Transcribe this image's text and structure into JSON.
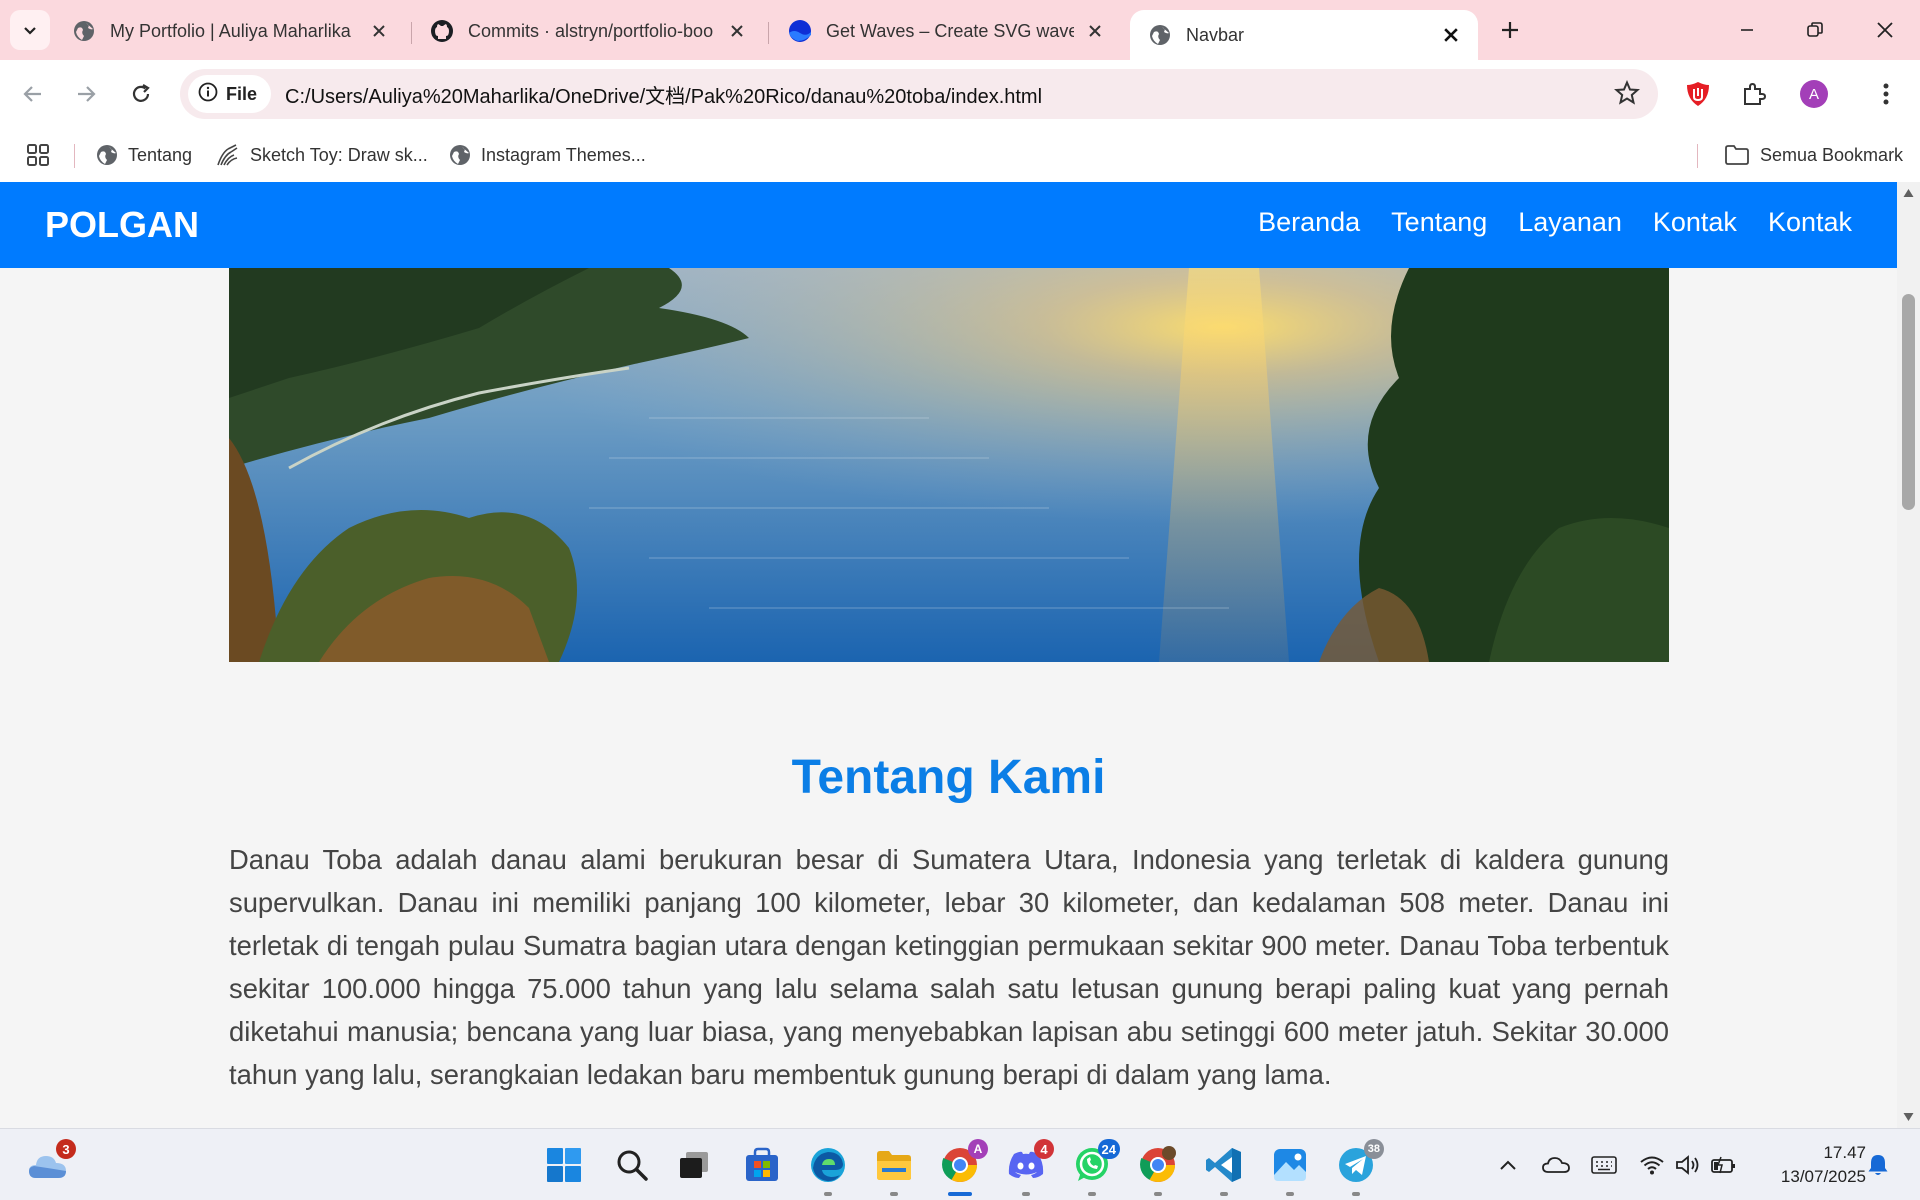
{
  "browser": {
    "tabs": [
      {
        "title": "My Portfolio | Auliya Maharlika",
        "icon": "globe-icon",
        "active": false
      },
      {
        "title": "Commits · alstryn/portfolio-boo",
        "icon": "github-icon",
        "active": false
      },
      {
        "title": "Get Waves – Create SVG waves",
        "icon": "getwaves-icon",
        "active": false
      },
      {
        "title": "Navbar",
        "icon": "globe-icon",
        "active": true
      }
    ],
    "site_chip": "File",
    "url": "C:/Users/Auliya%20Maharlika/OneDrive/文档/Pak%20Rico/danau%20toba/index.html",
    "profile_initial": "A",
    "bookmarks": [
      {
        "label": "Tentang",
        "icon": "globe-icon"
      },
      {
        "label": "Sketch Toy: Draw sk...",
        "icon": "sketch-icon"
      },
      {
        "label": "Instagram Themes...",
        "icon": "globe-icon"
      }
    ],
    "all_bookmarks": "Semua Bookmark"
  },
  "page": {
    "brand": "POLGAN",
    "nav": [
      "Beranda",
      "Tentang",
      "Layanan",
      "Kontak",
      "Kontak"
    ],
    "about": {
      "title": "Tentang Kami",
      "text": "Danau Toba adalah danau alami berukuran besar di Sumatera Utara, Indonesia yang terletak di kaldera gunung supervulkan. Danau ini memiliki panjang 100 kilometer, lebar 30 kilometer, dan kedalaman 508 meter. Danau ini terletak di tengah pulau Sumatra bagian utara dengan ketinggian permukaan sekitar 900 meter. Danau Toba terbentuk sekitar 100.000 hingga 75.000 tahun yang lalu selama salah satu letusan gunung berapi paling kuat yang pernah diketahui manusia; bencana yang luar biasa, yang menyebabkan lapisan abu setinggi 600 meter jatuh. Sekitar 30.000 tahun yang lalu, serangkaian ledakan baru membentuk gunung berapi di dalam yang lama."
    }
  },
  "taskbar": {
    "weather_badge": "3",
    "discord_badge": "4",
    "whatsapp_badge": "24",
    "telegram_badge": "38",
    "time": "17.47",
    "date": "13/07/2025"
  },
  "colors": {
    "navbar": "#007bff",
    "title": "#0b7ee6",
    "tabstrip": "#fbd9de"
  }
}
